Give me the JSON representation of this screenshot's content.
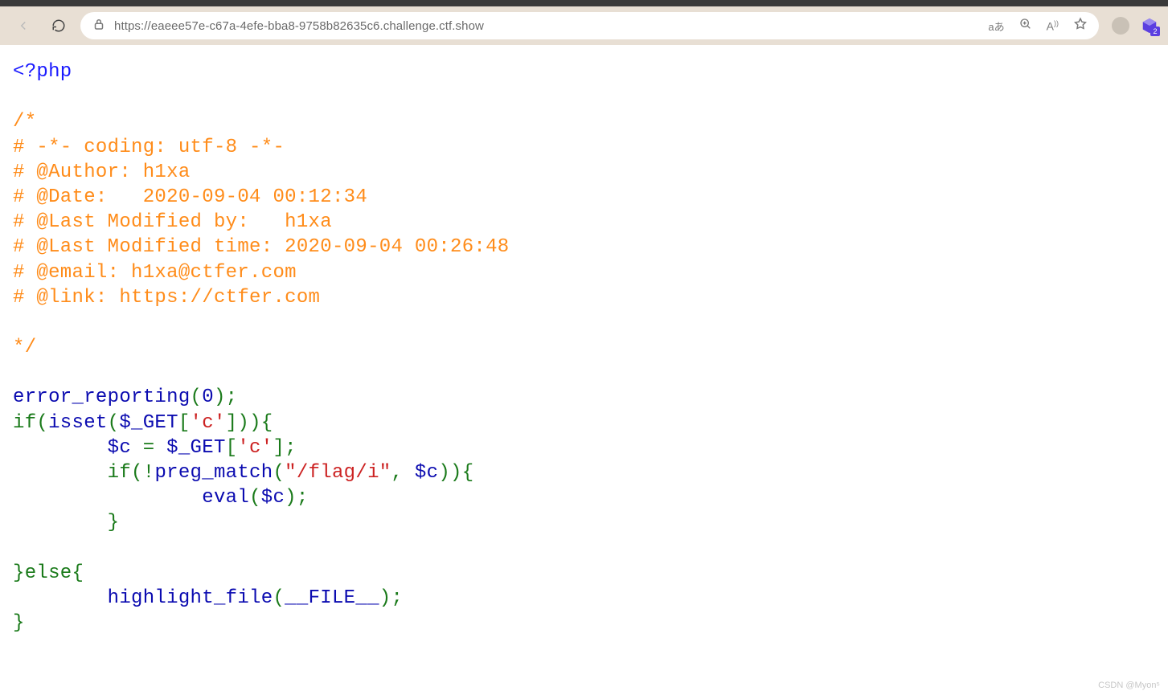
{
  "browser": {
    "url": "https://eaeee57e-c67a-4efe-bba8-9758b82635c6.challenge.ctf.show",
    "translate_label": "aあ",
    "ext_badge": "2"
  },
  "code": {
    "open_tag": "<?php",
    "comment_open": "/*",
    "c1": "# -*- coding: utf-8 -*-",
    "c2": "# @Author: h1xa",
    "c3": "# @Date:   2020-09-04 00:12:34",
    "c4": "# @Last Modified by:   h1xa",
    "c5": "# @Last Modified time: 2020-09-04 00:26:48",
    "c6": "# @email: h1xa@ctfer.com",
    "c7": "# @link: https://ctfer.com",
    "comment_close": "*/",
    "fn_error_reporting": "error_reporting",
    "zero": "0",
    "kw_if": "if",
    "fn_isset": "isset",
    "var_get": "$_GET",
    "str_c": "'c'",
    "var_c": "$c",
    "eq": " = ",
    "fn_preg_match": "preg_match",
    "str_flag": "\"/flag/i\"",
    "fn_eval": "eval",
    "kw_else": "else",
    "fn_highlight": "highlight_file",
    "const_file": "__FILE__",
    "semi": ";",
    "not": "!",
    "comma": ", ",
    "obr": "(",
    "cbr": ")",
    "osq": "[",
    "csq": "]",
    "ocur": "{",
    "ccur": "}"
  },
  "watermark": "CSDN @Myon⁵"
}
